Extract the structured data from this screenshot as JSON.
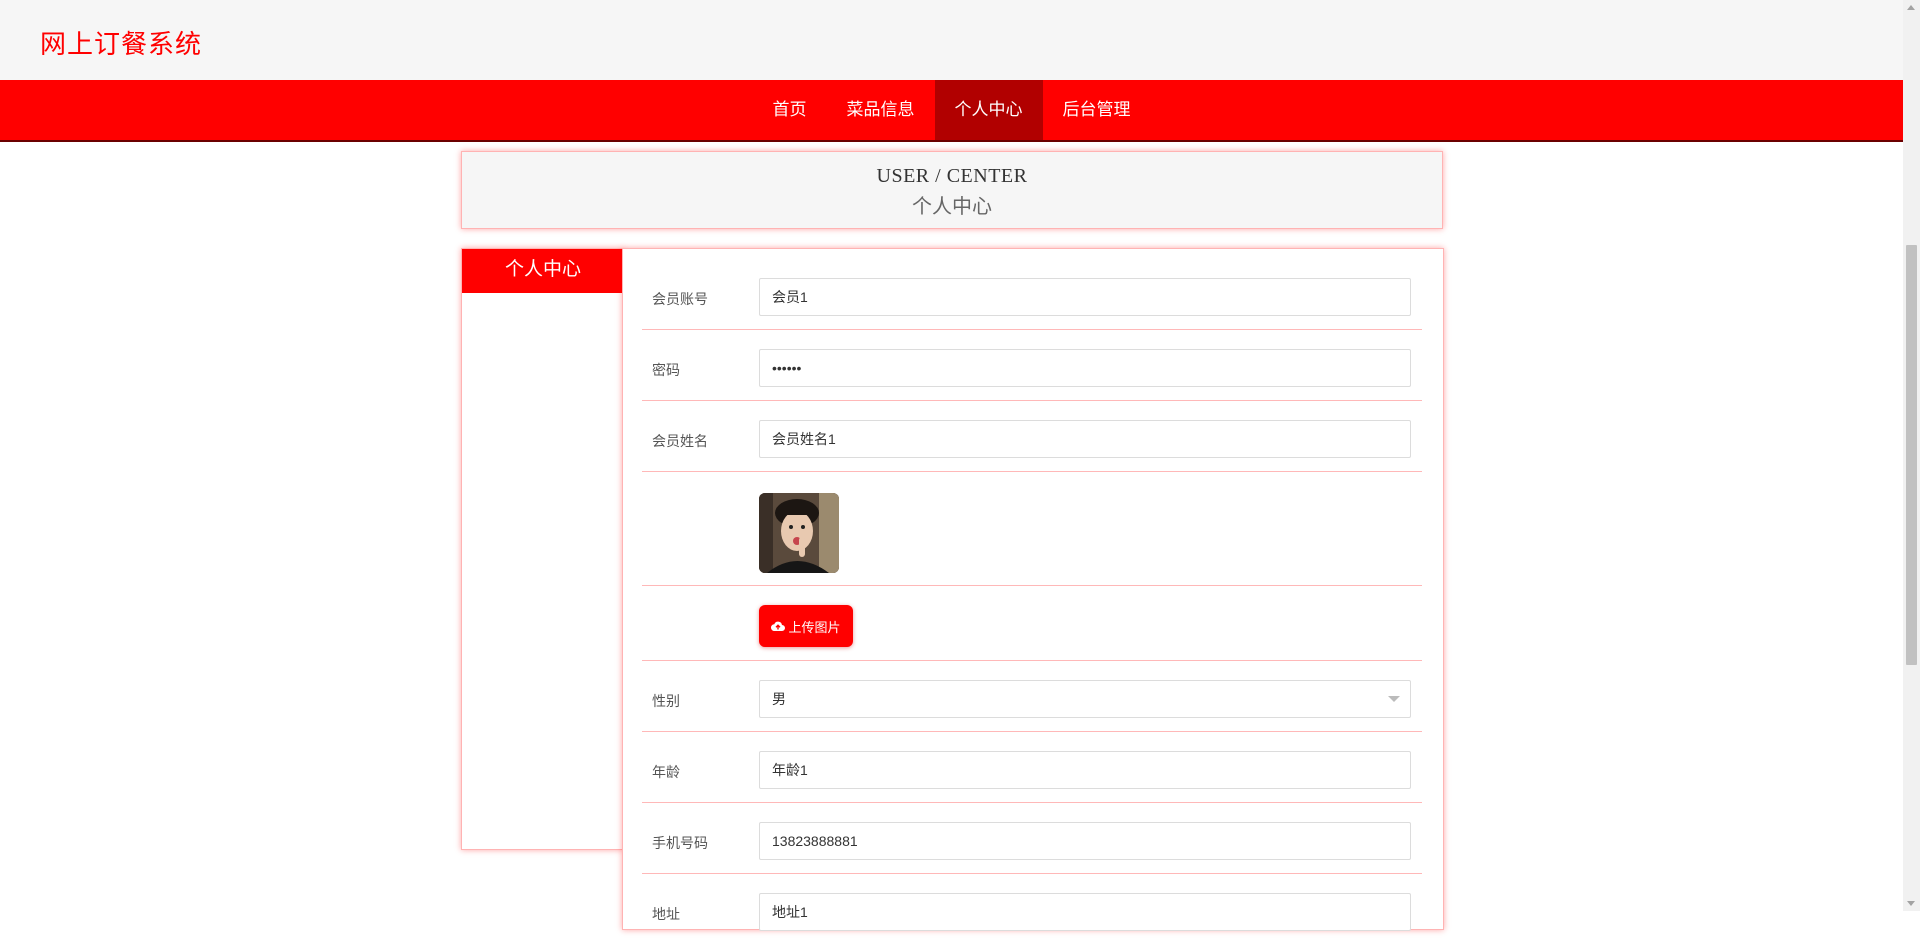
{
  "site": {
    "title": "网上订餐系统"
  },
  "nav": {
    "items": [
      {
        "label": "首页",
        "active": false
      },
      {
        "label": "菜品信息",
        "active": false
      },
      {
        "label": "个人中心",
        "active": true
      },
      {
        "label": "后台管理",
        "active": false
      }
    ]
  },
  "banner": {
    "title_en": "USER / CENTER",
    "title_cn": "个人中心"
  },
  "sidebar": {
    "heading": "个人中心"
  },
  "form": {
    "account": {
      "label": "会员账号",
      "value": "会员1"
    },
    "password": {
      "label": "密码",
      "value": "••••••"
    },
    "name": {
      "label": "会员姓名",
      "value": "会员姓名1"
    },
    "upload": {
      "label": "上传图片"
    },
    "gender": {
      "label": "性别",
      "value": "男"
    },
    "age": {
      "label": "年龄",
      "value": "年龄1"
    },
    "phone": {
      "label": "手机号码",
      "value": "13823888881"
    },
    "address": {
      "label": "地址",
      "value": "地址1"
    }
  },
  "colors": {
    "accent": "#ff0000",
    "accent_dark": "#b10000",
    "border": "#ffb3b3"
  }
}
